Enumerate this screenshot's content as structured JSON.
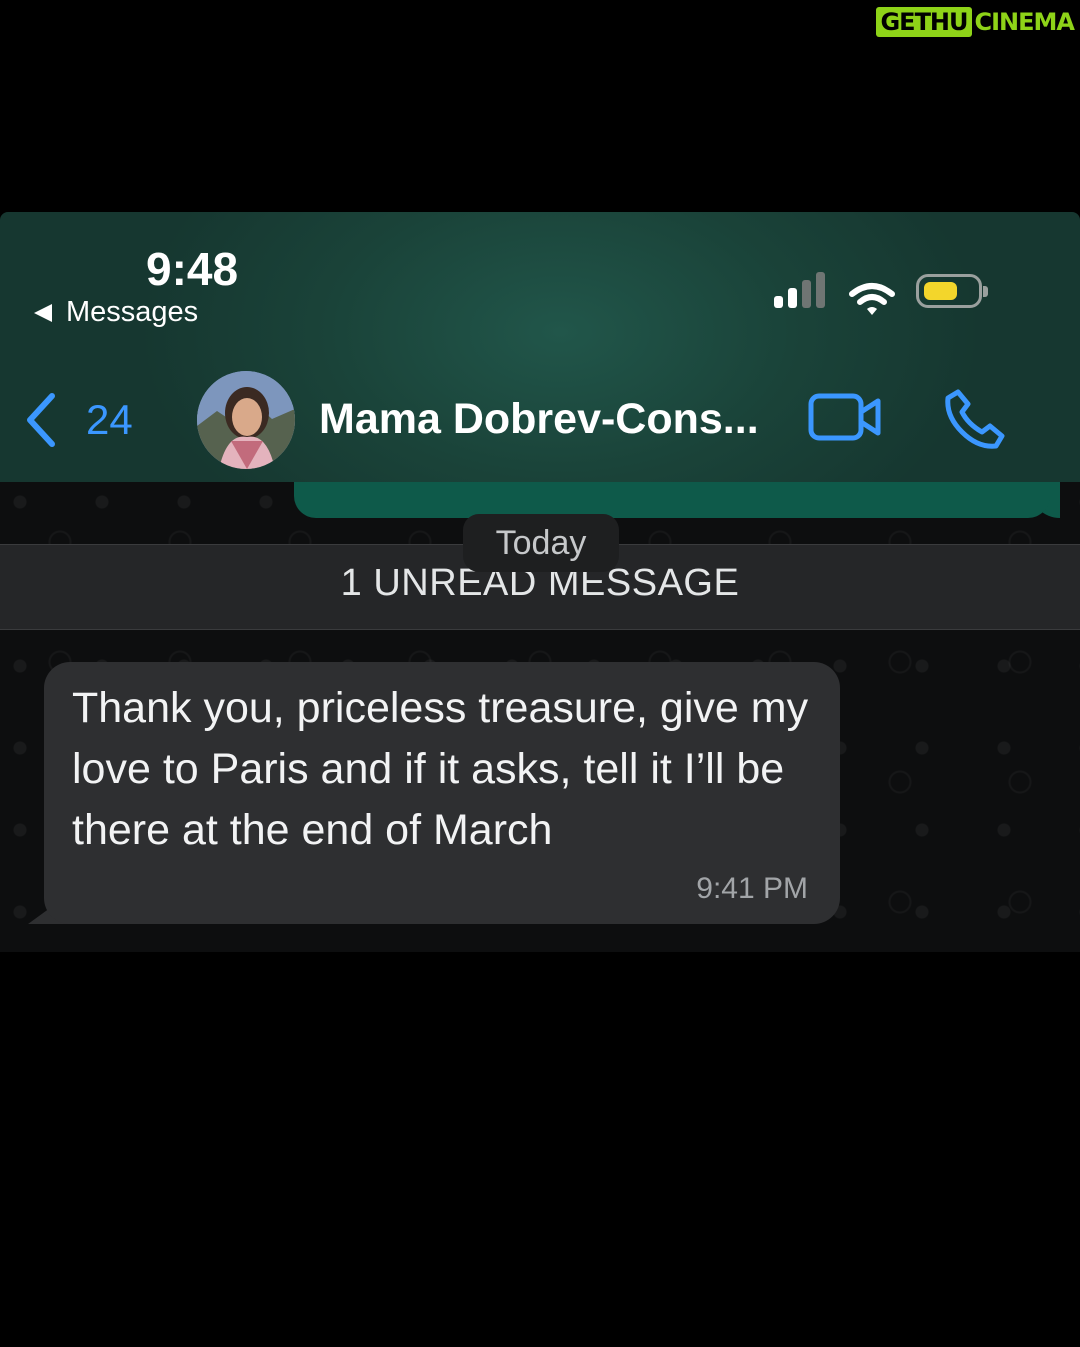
{
  "watermark": {
    "part1": "GETHU",
    "part2": "CINEMA"
  },
  "status_bar": {
    "time": "9:48",
    "back_app_label": "Messages",
    "battery_color": "#f3d62b"
  },
  "chat_header": {
    "back_count": "24",
    "contact_name": "Mama Dobrev-Cons...",
    "accent_color": "#3b97ff",
    "icons": [
      "chevron-left-icon",
      "video-call-icon",
      "phone-call-icon"
    ]
  },
  "chat": {
    "date_label": "Today",
    "unread_banner": "1 UNREAD MESSAGE",
    "messages": [
      {
        "direction": "incoming",
        "text": "Thank you, priceless treasure, give my love to Paris and if it asks, tell it I’ll be there at the end of March",
        "time": "9:41 PM"
      }
    ]
  }
}
